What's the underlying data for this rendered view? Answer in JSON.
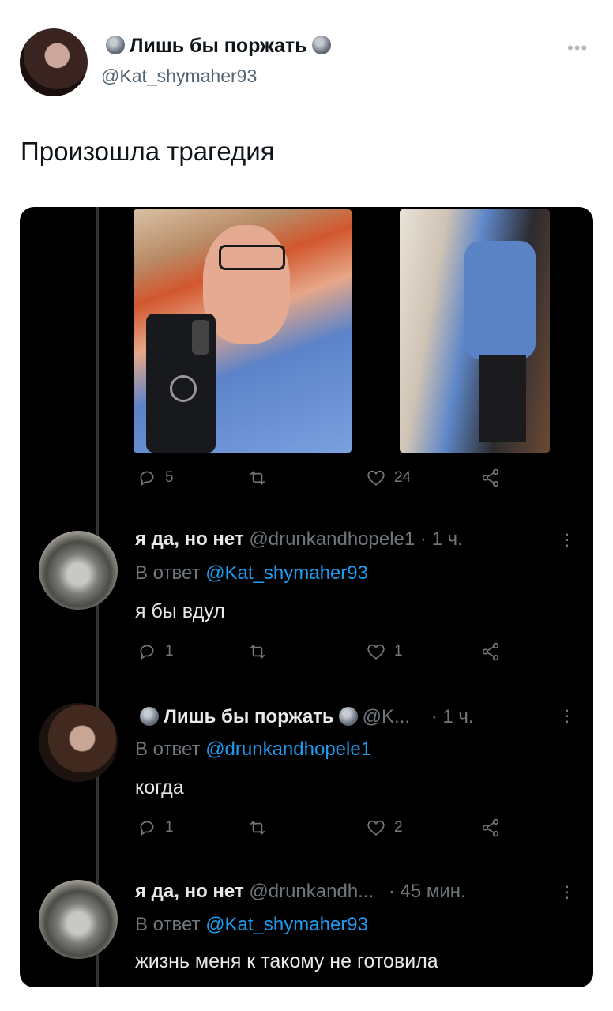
{
  "outer": {
    "name": "Лишь бы поржать",
    "handle": "@Kat_shymaher93",
    "text": "Произошла трагедия"
  },
  "main_actions": {
    "replies": "5",
    "likes": "24"
  },
  "replies": [
    {
      "name": "я да, но нет",
      "handle": "@drunkandhopele1",
      "time": "· 1 ч.",
      "reply_label": "В ответ",
      "reply_to": "@Kat_shymaher93",
      "text": "я бы вдул",
      "reply_count": "1",
      "like_count": "1"
    },
    {
      "name": "Лишь бы поржать",
      "handle": "@K...",
      "time": "· 1 ч.",
      "reply_label": "В ответ",
      "reply_to": "@drunkandhopele1",
      "text": "когда",
      "reply_count": "1",
      "like_count": "2"
    },
    {
      "name": "я да, но нет",
      "handle": "@drunkandh...",
      "time": "· 45 мин.",
      "reply_label": "В ответ",
      "reply_to": "@Kat_shymaher93",
      "text": "жизнь меня к такому не готовила"
    }
  ],
  "colors": {
    "link": "#1d9bf0",
    "dark_bg": "#000000",
    "muted": "#71767b"
  }
}
